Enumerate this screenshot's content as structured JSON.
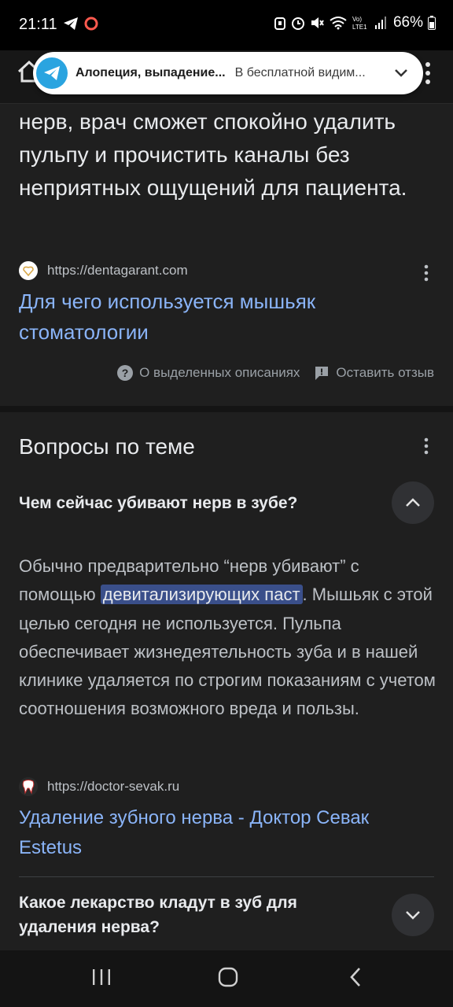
{
  "status_bar": {
    "time": "21:11",
    "battery": "66%",
    "icons_left": [
      "telegram-send-icon",
      "record-icon"
    ],
    "icons_right": [
      "alarm-icon",
      "clock-icon",
      "mute-icon",
      "wifi-icon",
      "volte-icon",
      "signal-icon",
      "battery-icon"
    ]
  },
  "notification": {
    "app": "telegram",
    "title": "Алопеция, выпадение...",
    "text": "В бесплатной видим..."
  },
  "snippet": {
    "text": "нерв, врач сможет спокойно удалить пульпу и прочистить каналы без неприятных ощущений для пациента.",
    "source_url": "https://dentagarant.com",
    "link_title": "Для чего используется мышьяк стоматологии"
  },
  "feedback": {
    "about_label": "О выделенных описаниях",
    "feedback_label": "Оставить отзыв"
  },
  "related": {
    "title": "Вопросы по теме",
    "questions": [
      {
        "question": "Чем сейчас убивают нерв в зубе?",
        "answer_before": "Обычно предварительно “нерв убивают” с помощью ",
        "answer_highlight": "девитализирующих паст",
        "answer_after": ". Мышьяк с этой целью сегодня не используется. Пульпа обеспечивает жизнедеятельность зуба и в нашей клинике удаляется по строгим показаниям с учетом соотношения возможного вреда и пользы.",
        "source_url": "https://doctor-sevak.ru",
        "link_title": "Удаление зубного нерва - Доктор Севак Estetus"
      },
      {
        "question": "Какое лекарство кладут в зуб для удаления нерва?"
      }
    ]
  },
  "colors": {
    "background": "#1f1f1f",
    "link": "#8ab4f8",
    "highlight": "#3a4f8a",
    "telegram": "#2aa4e0"
  }
}
